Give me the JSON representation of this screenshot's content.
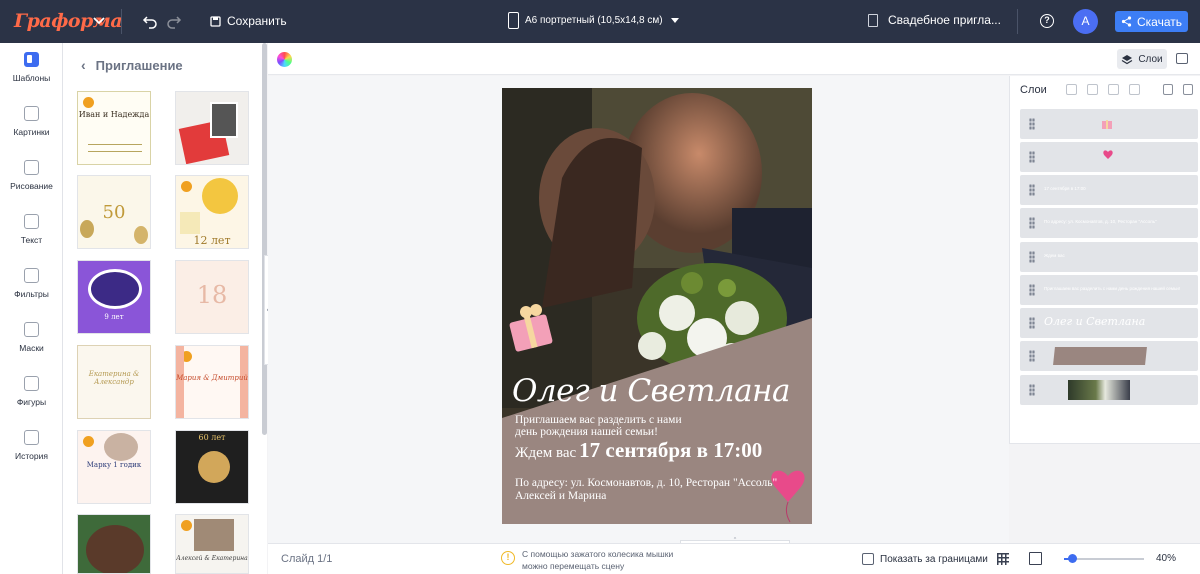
{
  "app": {
    "logo": "Граформа",
    "save_label": "Сохранить",
    "page_size": "А6 портретный (10,5x14,8 см)",
    "project_name": "Свадебное пригла...",
    "user_initial": "А",
    "download_label": "Скачать"
  },
  "rail": {
    "items": [
      {
        "label": "Шаблоны",
        "icon": "templates-icon"
      },
      {
        "label": "Картинки",
        "icon": "images-icon"
      },
      {
        "label": "Рисование",
        "icon": "drawing-icon"
      },
      {
        "label": "Текст",
        "icon": "text-icon"
      },
      {
        "label": "Фильтры",
        "icon": "filters-icon"
      },
      {
        "label": "Маски",
        "icon": "masks-icon"
      },
      {
        "label": "Фигуры",
        "icon": "shapes-icon"
      },
      {
        "label": "История",
        "icon": "history-icon"
      }
    ]
  },
  "panel": {
    "title": "Приглашение",
    "thumbs": [
      {
        "text": "Иван и Надежда"
      },
      {
        "text": ""
      },
      {
        "text": "50"
      },
      {
        "text": "12 лет"
      },
      {
        "text": "9 лет"
      },
      {
        "text": "18"
      },
      {
        "text": "Екатерина & Александр"
      },
      {
        "text": "Мария & Дмитрий"
      },
      {
        "text": "Марку 1 годик"
      },
      {
        "text": "60 лет"
      },
      {
        "text": ""
      },
      {
        "text": "Алексей & Екатерина"
      }
    ]
  },
  "toolbar": {
    "layers_label": "Слои"
  },
  "card": {
    "names": "Олег и Светлана",
    "invite_line1": "Приглашаем вас разделить с нами",
    "invite_line2": "день рождения нашей семьи!",
    "wait_prefix": "Ждем вас",
    "wait_date": "17 сентября в 17:00",
    "address_line1": "По адресу: ул. Космонавтов, д. 10, Ресторан \"Ассоль\"",
    "address_line2": "Алексей и Марина"
  },
  "layers": {
    "title": "Слои",
    "rows": [
      {
        "text": "",
        "kind": "gift"
      },
      {
        "text": "",
        "kind": "balloon"
      },
      {
        "text": "17 сентября в 17:00",
        "kind": "text"
      },
      {
        "text": "По адресу: ул. Космонавтов, д. 10, Ресторан \"Ассоль\"",
        "kind": "text"
      },
      {
        "text": "Ждем вас",
        "kind": "text"
      },
      {
        "text": "Приглашаем вас разделить с нами день рождения нашей семьи!",
        "kind": "text"
      },
      {
        "text": "Олег и Светлана",
        "kind": "names"
      },
      {
        "text": "",
        "kind": "shape"
      },
      {
        "text": "",
        "kind": "photo"
      }
    ]
  },
  "bottom": {
    "slide_label": "Слайд 1/1",
    "hint_line1": "С помощью зажатого колесика мышки",
    "hint_line2": "можно перемещать сцену",
    "show_outside_label": "Показать за границами",
    "zoom": "40%",
    "zoom_value": 0.4
  },
  "colors": {
    "topbar": "#2b3346",
    "accent": "#3d7ef5",
    "brand": "#ff6a48",
    "card_shape": "#9a8680"
  }
}
